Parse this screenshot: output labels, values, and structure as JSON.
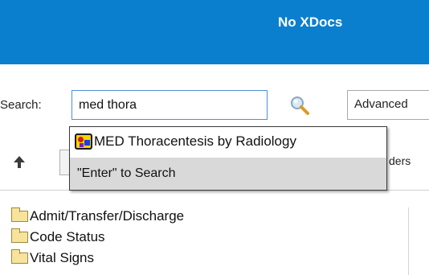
{
  "banner": {
    "title": "No XDocs"
  },
  "search": {
    "label": "Search:",
    "value": "med thora",
    "advanced_label": "Advanced"
  },
  "toolbar": {
    "orders_tail": "ders"
  },
  "dropdown": {
    "suggestion": "MED Thoracentesis by Radiology",
    "enter_hint": "\"Enter\" to Search"
  },
  "tree": {
    "items": [
      {
        "label": "Admit/Transfer/Discharge"
      },
      {
        "label": "Code Status"
      },
      {
        "label": "Vital Signs"
      }
    ]
  },
  "colors": {
    "banner_bg": "#0a7fce",
    "input_border": "#4f8fd6",
    "enter_row_bg": "#d9d9d9"
  },
  "icons": {
    "search": "magnifier-icon",
    "up": "up-arrow-icon",
    "order_set": "order-set-icon",
    "folder": "folder-icon"
  }
}
